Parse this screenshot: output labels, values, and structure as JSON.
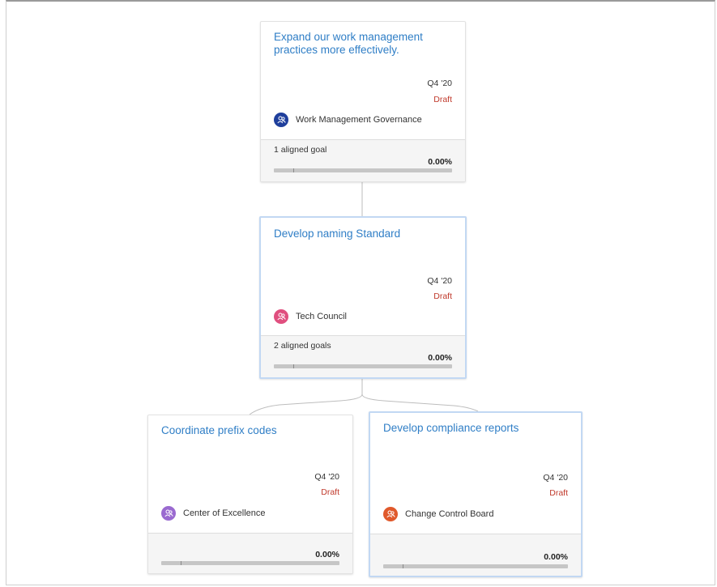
{
  "cards": [
    {
      "id": "card1",
      "title": "Expand our work management practices more effectively.",
      "quarter": "Q4 '20",
      "status": "Draft",
      "team": "Work Management Governance",
      "team_color": "#1f3f9c",
      "aligned": "1 aligned goal",
      "progress_text": "0.00%",
      "progress": 0.0
    },
    {
      "id": "card2",
      "title": "Develop naming Standard",
      "quarter": "Q4 '20",
      "status": "Draft",
      "team": "Tech Council",
      "team_color": "#e04f7f",
      "aligned": "2 aligned goals",
      "progress_text": "0.00%",
      "progress": 0.0
    },
    {
      "id": "card3",
      "title": "Coordinate prefix codes",
      "quarter": "Q4 '20",
      "status": "Draft",
      "team": "Center of Excellence",
      "team_color": "#9a6ad0",
      "aligned": "",
      "progress_text": "0.00%",
      "progress": 0.0
    },
    {
      "id": "card4",
      "title": "Develop compliance reports",
      "quarter": "Q4 '20",
      "status": "Draft",
      "team": "Change Control Board",
      "team_color": "#e0592b",
      "aligned": "",
      "progress_text": "0.00%",
      "progress": 0.0
    }
  ],
  "icons": {
    "team": "team-icon"
  },
  "colors": {
    "title": "#2f7ec6",
    "draft": "#c0392b",
    "selected_border": "#c2d8f3"
  }
}
